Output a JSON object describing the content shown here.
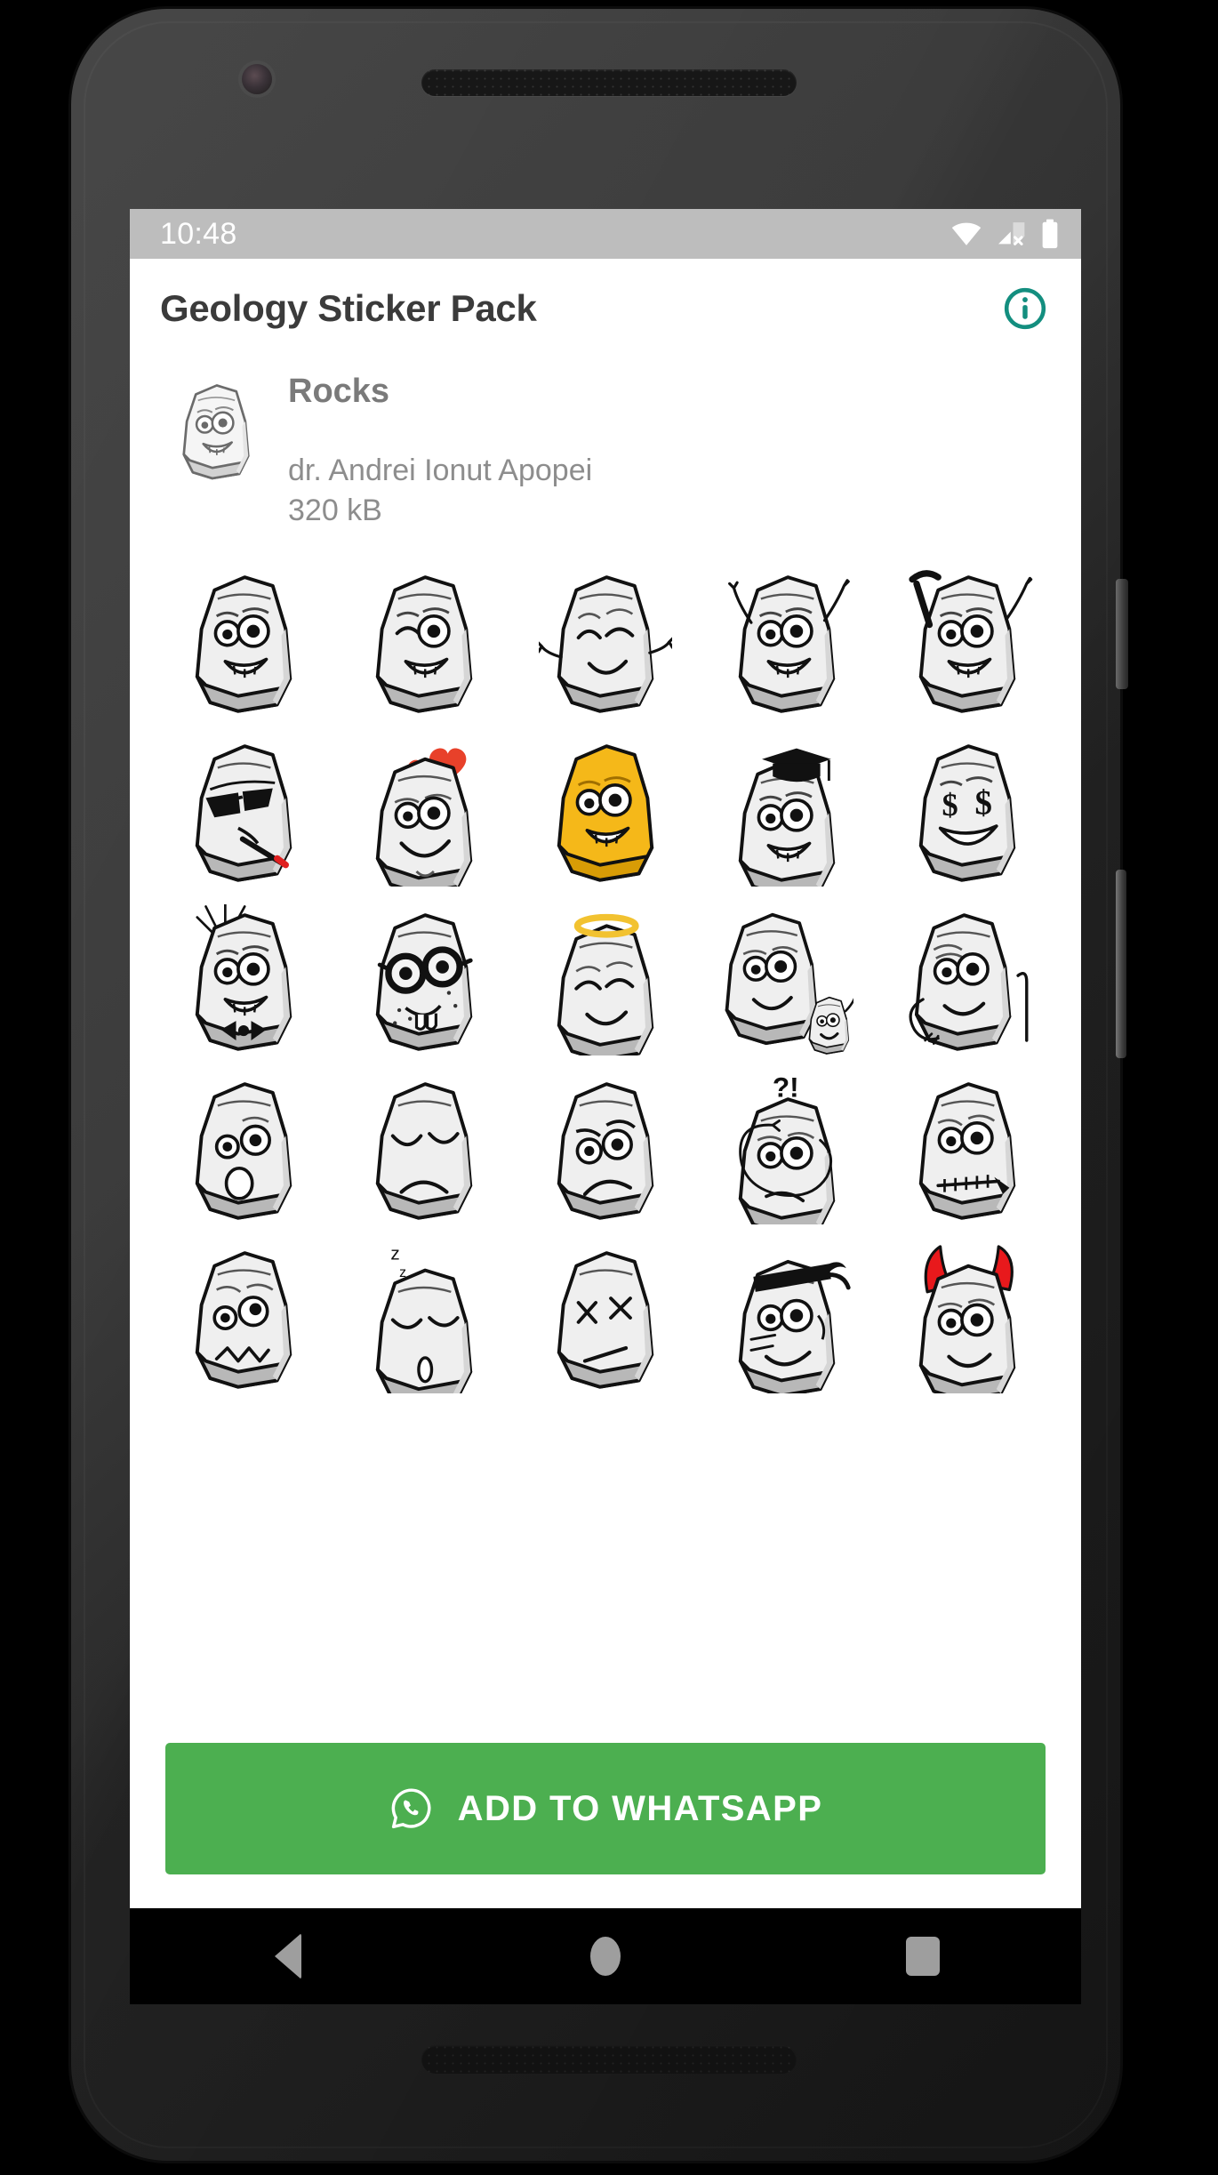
{
  "device": {
    "frame": "android-phone",
    "hardware": {
      "front_camera": "front-camera",
      "earpiece": "earpiece-speaker",
      "power_button": "power-button",
      "volume_button": "volume-button",
      "bottom_speaker": "bottom-speaker"
    }
  },
  "status_bar": {
    "time": "10:48",
    "background": "#bdbdbd",
    "icons": [
      "wifi-icon",
      "cellular-no-sim-icon",
      "battery-full-icon"
    ]
  },
  "app_bar": {
    "title": "Geology Sticker Pack",
    "info_icon": "info-circle-icon",
    "accent_color": "#009688"
  },
  "pack": {
    "tray_icon": "rock-smile-tray-icon",
    "name": "Rocks",
    "author": "dr. Andrei Ionut Apopei",
    "size": "320 kB"
  },
  "stickers": [
    {
      "id": "rock-smile",
      "label": "smiling rock",
      "row": 1,
      "col": 1
    },
    {
      "id": "rock-wink",
      "label": "winking rock",
      "row": 1,
      "col": 2
    },
    {
      "id": "rock-happy-arms",
      "label": "happy rock with arms",
      "row": 1,
      "col": 3
    },
    {
      "id": "rock-waving",
      "label": "waving rock",
      "row": 1,
      "col": 4
    },
    {
      "id": "rock-hammer",
      "label": "rock with geology hammer",
      "row": 1,
      "col": 5
    },
    {
      "id": "rock-cool-cigar",
      "label": "cool rock sunglasses cigarette",
      "row": 2,
      "col": 1
    },
    {
      "id": "rock-love",
      "label": "rock in love with hearts",
      "row": 2,
      "col": 2
    },
    {
      "id": "rock-gold",
      "label": "gold yellow rock",
      "row": 2,
      "col": 3
    },
    {
      "id": "rock-graduate",
      "label": "graduate rock with cap",
      "row": 2,
      "col": 4
    },
    {
      "id": "rock-money-eyes",
      "label": "rock with dollar sign eyes",
      "row": 2,
      "col": 5
    },
    {
      "id": "rock-bowtie",
      "label": "rock with bow tie and hair",
      "row": 3,
      "col": 1
    },
    {
      "id": "rock-nerd",
      "label": "nerd rock with glasses",
      "row": 3,
      "col": 2
    },
    {
      "id": "rock-angel",
      "label": "angel rock with halo",
      "row": 3,
      "col": 3
    },
    {
      "id": "rock-parent-child",
      "label": "rock with small rock child",
      "row": 3,
      "col": 4
    },
    {
      "id": "rock-elder-cane",
      "label": "old rock with walking cane",
      "row": 3,
      "col": 5
    },
    {
      "id": "rock-surprised",
      "label": "surprised rock",
      "row": 4,
      "col": 1
    },
    {
      "id": "rock-sad",
      "label": "sad rock",
      "row": 4,
      "col": 2
    },
    {
      "id": "rock-frown",
      "label": "frowning rock",
      "row": 4,
      "col": 3
    },
    {
      "id": "rock-confused",
      "label": "confused rock question exclamation",
      "row": 4,
      "col": 4
    },
    {
      "id": "rock-zipped",
      "label": "rock with stitched mouth",
      "row": 4,
      "col": 5
    },
    {
      "id": "rock-worried",
      "label": "worried rock wavy mouth",
      "row": 5,
      "col": 1
    },
    {
      "id": "rock-sleeping",
      "label": "sleeping rock zzz",
      "row": 5,
      "col": 2
    },
    {
      "id": "rock-dead",
      "label": "dead rock x eyes",
      "row": 5,
      "col": 3
    },
    {
      "id": "rock-ninja",
      "label": "ninja rock with headband",
      "row": 5,
      "col": 4
    },
    {
      "id": "rock-devil",
      "label": "devil rock with horns",
      "row": 5,
      "col": 5
    }
  ],
  "sticker_annotations": {
    "confused": "?!",
    "sleeping": [
      "z",
      "z",
      "z"
    ],
    "dead_eyes": [
      "x",
      "x"
    ],
    "money_eyes": [
      "$",
      "$"
    ]
  },
  "cta": {
    "label": "ADD TO WHATSAPP",
    "icon": "whatsapp-icon",
    "color": "#4caf50",
    "text_color": "#ffffff"
  },
  "nav_bar": {
    "back": "back-triangle-icon",
    "home": "home-circle-icon",
    "recents": "recents-square-icon",
    "background": "#000000"
  },
  "colors": {
    "rock_light": "#f0f0f0",
    "rock_shadow": "#b5b5b5",
    "rock_outline": "#111111",
    "gold": "#f5b819",
    "heart_red": "#e8412a",
    "devil_red": "#e8191c",
    "halo_gold": "#f2c230"
  }
}
